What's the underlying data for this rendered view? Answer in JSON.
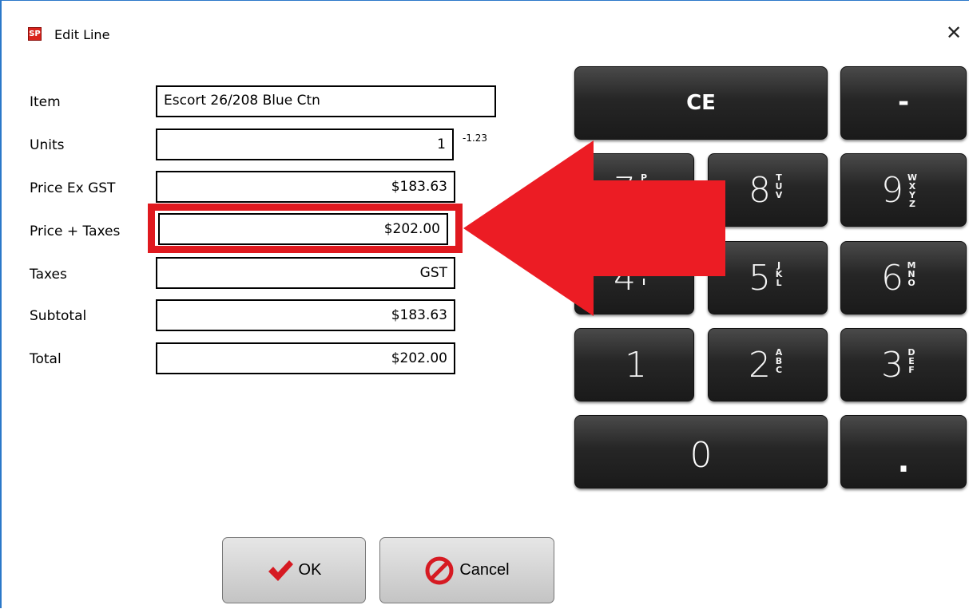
{
  "window": {
    "title": "Edit Line",
    "app_icon_text": "SP"
  },
  "form": {
    "item_label": "Item",
    "item_value": "Escort 26/208 Blue Ctn",
    "units_label": "Units",
    "units_value": "1",
    "units_hint": "-1.23",
    "price_ex_label": "Price Ex GST",
    "price_ex_value": "$183.63",
    "price_taxes_label": "Price + Taxes",
    "price_taxes_value": "$202.00",
    "taxes_label": "Taxes",
    "taxes_value": "GST",
    "subtotal_label": "Subtotal",
    "subtotal_value": "$183.63",
    "total_label": "Total",
    "total_value": "$202.00"
  },
  "keypad": {
    "ce": "CE",
    "minus": "-",
    "k7": "7",
    "k7_letters": "P",
    "k8": "8",
    "k8_letters": "TUV",
    "k9": "9",
    "k9_letters": "WXYZ",
    "k4": "4",
    "k4_letters": "HI",
    "k5": "5",
    "k5_letters": "JKL",
    "k6": "6",
    "k6_letters": "MNO",
    "k1": "1",
    "k2": "2",
    "k2_letters": "ABC",
    "k3": "3",
    "k3_letters": "DEF",
    "k0": "0",
    "dot": "."
  },
  "buttons": {
    "ok": "OK",
    "cancel": "Cancel"
  },
  "colors": {
    "annotation_red": "#e0191f",
    "window_border": "#2b78c9",
    "key_bg": "#262626"
  }
}
